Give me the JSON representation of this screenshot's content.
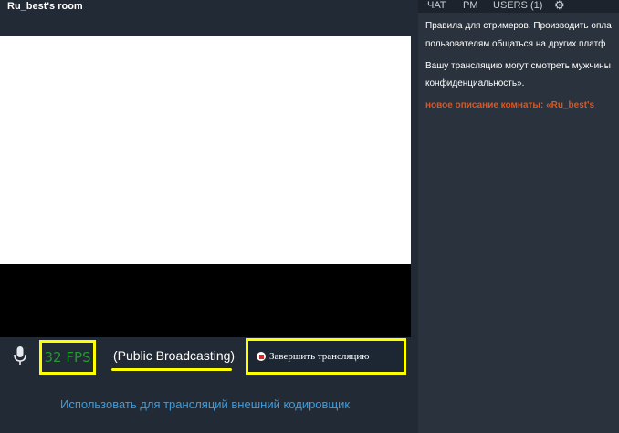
{
  "room": {
    "title": "Ru_best's room"
  },
  "controls": {
    "fps": "32 FPS",
    "broadcast_status": "(Public Broadcasting)",
    "stop_label": "Завершить трансляцию",
    "mic_icon": "microphone-icon",
    "stop_icon": "stop-icon"
  },
  "encoder_link": "Использовать для трансляций внешний кодировщик",
  "chat": {
    "tabs": [
      "ЧАТ",
      "PM",
      "USERS (1)"
    ],
    "settings_icon": "gear-icon",
    "lines": [
      "Правила для стримеров. Производить опла",
      "пользователям общаться на других платф",
      "Вашу трансляцию могут смотреть мужчины",
      "конфиденциальность»."
    ],
    "room_description": "новое описание комнаты: «Ru_best's"
  },
  "colors": {
    "accent_highlight": "#ffff00",
    "fps_text": "#1f9b2a",
    "link": "#3f9ddc",
    "description": "#e2541b"
  }
}
